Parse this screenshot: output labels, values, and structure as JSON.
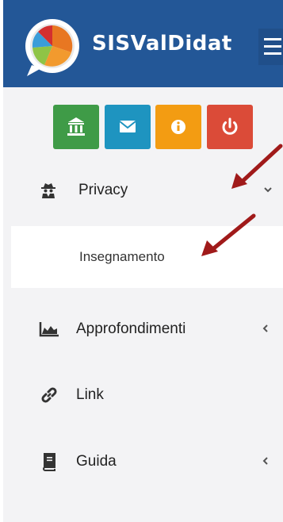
{
  "header": {
    "brand": "SISValDidat"
  },
  "toolbar": {
    "buttons": [
      {
        "name": "home",
        "icon": "bank-icon",
        "color": "#3f9b47"
      },
      {
        "name": "mail",
        "icon": "envelope-icon",
        "color": "#1e94c0"
      },
      {
        "name": "info",
        "icon": "info-icon",
        "color": "#f39c12"
      },
      {
        "name": "power",
        "icon": "power-icon",
        "color": "#db4b38"
      }
    ]
  },
  "menu": {
    "privacy": {
      "label": "Privacy",
      "icon": "user-secret-icon",
      "expanded": true
    },
    "insegnamento": {
      "label": "Insegnamento"
    },
    "approfondimenti": {
      "label": "Approfondimenti",
      "icon": "area-chart-icon"
    },
    "link": {
      "label": "Link",
      "icon": "link-icon"
    },
    "guida": {
      "label": "Guida",
      "icon": "book-icon"
    }
  },
  "annotations": {
    "arrow_color": "#a01a1a"
  }
}
